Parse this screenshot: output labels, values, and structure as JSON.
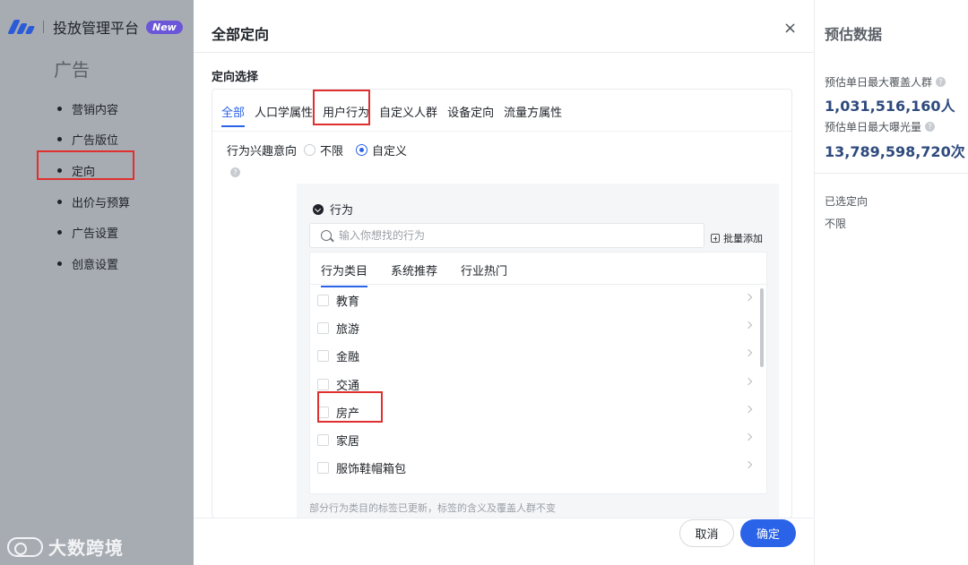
{
  "app": {
    "title": "投放管理平台",
    "badge": "New",
    "left_heading": "广告"
  },
  "nav": {
    "items": [
      {
        "label": "营销内容"
      },
      {
        "label": "广告版位"
      },
      {
        "label": "定向"
      },
      {
        "label": "出价与预算"
      },
      {
        "label": "广告设置"
      },
      {
        "label": "创意设置"
      }
    ]
  },
  "watermark": "大数跨境",
  "modal": {
    "title": "全部定向",
    "close": "×",
    "section_label": "定向选择",
    "tabs": [
      "全部",
      "人口学属性",
      "用户行为",
      "自定义人群",
      "设备定向",
      "流量方属性"
    ],
    "active_tab": "全部",
    "row_label": "行为兴趣意向",
    "help": "?",
    "radios": [
      {
        "label": "不限",
        "checked": false
      },
      {
        "label": "自定义",
        "checked": true
      }
    ],
    "behavior": {
      "header": "行为",
      "search_placeholder": "输入你想找的行为",
      "bulk_add": "批量添加",
      "sub_tabs": [
        "行为类目",
        "系统推荐",
        "行业热门"
      ],
      "categories": [
        "教育",
        "旅游",
        "金融",
        "交通",
        "房产",
        "家居",
        "服饰鞋帽箱包"
      ],
      "hint": "部分行为类目的标签已更新，标签的含义及覆盖人群不变"
    },
    "buttons": {
      "cancel": "取消",
      "ok": "确定"
    }
  },
  "estimate": {
    "title": "预估数据",
    "audience_label": "预估单日最大覆盖人群",
    "audience_value": "1,031,516,160人",
    "exposure_label": "预估单日最大曝光量",
    "exposure_value": "13,789,598,720次",
    "selected_label": "已选定向",
    "selected_value": "不限",
    "help": "?"
  },
  "colors": {
    "accent": "#2b63e8",
    "highlight": "#e02f2f",
    "overlay": "#a7acb2",
    "value_text": "#2e4a7d"
  }
}
